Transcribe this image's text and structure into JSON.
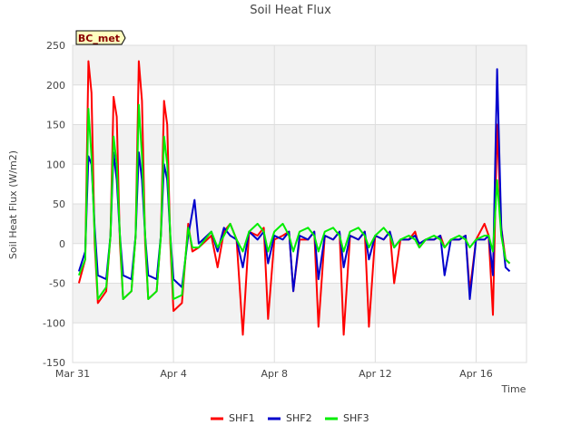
{
  "chart_data": {
    "type": "line",
    "title": "Soil Heat Flux",
    "xlabel": "Time",
    "ylabel": "Soil Heat Flux (W/m2)",
    "badge": "BC_met",
    "ylim": [
      -150,
      250
    ],
    "yticks": [
      -150,
      -100,
      -50,
      0,
      50,
      100,
      150,
      200,
      250
    ],
    "xlim": [
      "2024-03-31",
      "2024-04-18"
    ],
    "xticks": [
      {
        "x": "2024-03-31",
        "label": "Mar 31"
      },
      {
        "x": "2024-04-04",
        "label": "Apr 4"
      },
      {
        "x": "2024-04-08",
        "label": "Apr 8"
      },
      {
        "x": "2024-04-12",
        "label": "Apr 12"
      },
      {
        "x": "2024-04-16",
        "label": "Apr 16"
      }
    ],
    "legend_position": "bottom",
    "grid": true,
    "series": [
      {
        "name": "SHF1",
        "color": "#ff0000",
        "points": [
          [
            "2024-03-31 06:00",
            -50
          ],
          [
            "2024-03-31 12:00",
            -20
          ],
          [
            "2024-03-31 15:00",
            230
          ],
          [
            "2024-03-31 18:00",
            190
          ],
          [
            "2024-03-31 21:00",
            0
          ],
          [
            "2024-04-01 00:00",
            -75
          ],
          [
            "2024-04-01 08:00",
            -60
          ],
          [
            "2024-04-01 12:00",
            10
          ],
          [
            "2024-04-01 15:00",
            185
          ],
          [
            "2024-04-01 18:00",
            160
          ],
          [
            "2024-04-01 21:00",
            0
          ],
          [
            "2024-04-02 00:00",
            -70
          ],
          [
            "2024-04-02 08:00",
            -60
          ],
          [
            "2024-04-02 12:00",
            10
          ],
          [
            "2024-04-02 15:00",
            230
          ],
          [
            "2024-04-02 18:00",
            180
          ],
          [
            "2024-04-02 21:00",
            0
          ],
          [
            "2024-04-03 00:00",
            -70
          ],
          [
            "2024-04-03 08:00",
            -60
          ],
          [
            "2024-04-03 12:00",
            10
          ],
          [
            "2024-04-03 15:00",
            180
          ],
          [
            "2024-04-03 18:00",
            150
          ],
          [
            "2024-04-03 21:00",
            0
          ],
          [
            "2024-04-04 00:00",
            -85
          ],
          [
            "2024-04-04 08:00",
            -75
          ],
          [
            "2024-04-04 14:00",
            25
          ],
          [
            "2024-04-04 18:00",
            -10
          ],
          [
            "2024-04-05 00:00",
            -5
          ],
          [
            "2024-04-05 12:00",
            10
          ],
          [
            "2024-04-05 18:00",
            -30
          ],
          [
            "2024-04-06 00:00",
            15
          ],
          [
            "2024-04-06 06:00",
            25
          ],
          [
            "2024-04-06 12:00",
            5
          ],
          [
            "2024-04-06 18:00",
            -115
          ],
          [
            "2024-04-07 00:00",
            15
          ],
          [
            "2024-04-07 08:00",
            10
          ],
          [
            "2024-04-07 14:00",
            20
          ],
          [
            "2024-04-07 18:00",
            -95
          ],
          [
            "2024-04-08 00:00",
            5
          ],
          [
            "2024-04-08 08:00",
            10
          ],
          [
            "2024-04-08 14:00",
            15
          ],
          [
            "2024-04-08 18:00",
            -60
          ],
          [
            "2024-04-09 00:00",
            5
          ],
          [
            "2024-04-09 08:00",
            5
          ],
          [
            "2024-04-09 14:00",
            15
          ],
          [
            "2024-04-09 18:00",
            -105
          ],
          [
            "2024-04-10 00:00",
            10
          ],
          [
            "2024-04-10 08:00",
            5
          ],
          [
            "2024-04-10 14:00",
            15
          ],
          [
            "2024-04-10 18:00",
            -115
          ],
          [
            "2024-04-11 00:00",
            10
          ],
          [
            "2024-04-11 08:00",
            5
          ],
          [
            "2024-04-11 14:00",
            15
          ],
          [
            "2024-04-11 18:00",
            -105
          ],
          [
            "2024-04-12 00:00",
            10
          ],
          [
            "2024-04-12 08:00",
            5
          ],
          [
            "2024-04-12 14:00",
            15
          ],
          [
            "2024-04-12 18:00",
            -50
          ],
          [
            "2024-04-13 00:00",
            5
          ],
          [
            "2024-04-13 08:00",
            5
          ],
          [
            "2024-04-13 14:00",
            15
          ],
          [
            "2024-04-13 18:00",
            -5
          ],
          [
            "2024-04-14 00:00",
            5
          ],
          [
            "2024-04-14 08:00",
            5
          ],
          [
            "2024-04-14 14:00",
            10
          ],
          [
            "2024-04-14 18:00",
            -5
          ],
          [
            "2024-04-15 00:00",
            5
          ],
          [
            "2024-04-15 08:00",
            5
          ],
          [
            "2024-04-15 14:00",
            10
          ],
          [
            "2024-04-15 18:00",
            -60
          ],
          [
            "2024-04-16 00:00",
            5
          ],
          [
            "2024-04-16 08:00",
            25
          ],
          [
            "2024-04-16 12:00",
            10
          ],
          [
            "2024-04-16 16:00",
            -90
          ],
          [
            "2024-04-16 20:00",
            150
          ],
          [
            "2024-04-17 00:00",
            20
          ],
          [
            "2024-04-17 04:00",
            -20
          ],
          [
            "2024-04-17 08:00",
            -25
          ]
        ]
      },
      {
        "name": "SHF2",
        "color": "#0000cc",
        "points": [
          [
            "2024-03-31 06:00",
            -35
          ],
          [
            "2024-03-31 12:00",
            -10
          ],
          [
            "2024-03-31 15:00",
            110
          ],
          [
            "2024-03-31 18:00",
            100
          ],
          [
            "2024-03-31 21:00",
            20
          ],
          [
            "2024-04-01 00:00",
            -40
          ],
          [
            "2024-04-01 08:00",
            -45
          ],
          [
            "2024-04-01 12:00",
            10
          ],
          [
            "2024-04-01 15:00",
            115
          ],
          [
            "2024-04-01 18:00",
            80
          ],
          [
            "2024-04-01 21:00",
            10
          ],
          [
            "2024-04-02 00:00",
            -40
          ],
          [
            "2024-04-02 08:00",
            -45
          ],
          [
            "2024-04-02 12:00",
            10
          ],
          [
            "2024-04-02 15:00",
            115
          ],
          [
            "2024-04-02 18:00",
            80
          ],
          [
            "2024-04-02 21:00",
            10
          ],
          [
            "2024-04-03 00:00",
            -40
          ],
          [
            "2024-04-03 08:00",
            -45
          ],
          [
            "2024-04-03 12:00",
            10
          ],
          [
            "2024-04-03 15:00",
            100
          ],
          [
            "2024-04-03 18:00",
            80
          ],
          [
            "2024-04-03 21:00",
            10
          ],
          [
            "2024-04-04 00:00",
            -45
          ],
          [
            "2024-04-04 08:00",
            -55
          ],
          [
            "2024-04-04 14:00",
            10
          ],
          [
            "2024-04-04 20:00",
            55
          ],
          [
            "2024-04-05 00:00",
            0
          ],
          [
            "2024-04-05 12:00",
            15
          ],
          [
            "2024-04-05 18:00",
            -10
          ],
          [
            "2024-04-06 00:00",
            20
          ],
          [
            "2024-04-06 06:00",
            10
          ],
          [
            "2024-04-06 12:00",
            5
          ],
          [
            "2024-04-06 18:00",
            -30
          ],
          [
            "2024-04-07 00:00",
            15
          ],
          [
            "2024-04-07 08:00",
            5
          ],
          [
            "2024-04-07 14:00",
            15
          ],
          [
            "2024-04-07 18:00",
            -25
          ],
          [
            "2024-04-08 00:00",
            10
          ],
          [
            "2024-04-08 08:00",
            5
          ],
          [
            "2024-04-08 14:00",
            15
          ],
          [
            "2024-04-08 18:00",
            -60
          ],
          [
            "2024-04-09 00:00",
            10
          ],
          [
            "2024-04-09 08:00",
            5
          ],
          [
            "2024-04-09 14:00",
            15
          ],
          [
            "2024-04-09 18:00",
            -45
          ],
          [
            "2024-04-10 00:00",
            10
          ],
          [
            "2024-04-10 08:00",
            5
          ],
          [
            "2024-04-10 14:00",
            15
          ],
          [
            "2024-04-10 18:00",
            -30
          ],
          [
            "2024-04-11 00:00",
            10
          ],
          [
            "2024-04-11 08:00",
            5
          ],
          [
            "2024-04-11 14:00",
            15
          ],
          [
            "2024-04-11 18:00",
            -20
          ],
          [
            "2024-04-12 00:00",
            10
          ],
          [
            "2024-04-12 08:00",
            5
          ],
          [
            "2024-04-12 14:00",
            15
          ],
          [
            "2024-04-12 18:00",
            -5
          ],
          [
            "2024-04-13 00:00",
            5
          ],
          [
            "2024-04-13 08:00",
            5
          ],
          [
            "2024-04-13 14:00",
            10
          ],
          [
            "2024-04-13 18:00",
            0
          ],
          [
            "2024-04-14 00:00",
            5
          ],
          [
            "2024-04-14 08:00",
            5
          ],
          [
            "2024-04-14 14:00",
            10
          ],
          [
            "2024-04-14 18:00",
            -40
          ],
          [
            "2024-04-15 00:00",
            5
          ],
          [
            "2024-04-15 08:00",
            5
          ],
          [
            "2024-04-15 14:00",
            10
          ],
          [
            "2024-04-15 18:00",
            -70
          ],
          [
            "2024-04-16 00:00",
            5
          ],
          [
            "2024-04-16 08:00",
            5
          ],
          [
            "2024-04-16 12:00",
            10
          ],
          [
            "2024-04-16 16:00",
            -40
          ],
          [
            "2024-04-16 20:00",
            220
          ],
          [
            "2024-04-17 00:00",
            20
          ],
          [
            "2024-04-17 04:00",
            -30
          ],
          [
            "2024-04-17 08:00",
            -35
          ]
        ]
      },
      {
        "name": "SHF3",
        "color": "#00ee00",
        "points": [
          [
            "2024-03-31 06:00",
            -40
          ],
          [
            "2024-03-31 12:00",
            -20
          ],
          [
            "2024-03-31 15:00",
            170
          ],
          [
            "2024-03-31 18:00",
            110
          ],
          [
            "2024-03-31 21:00",
            10
          ],
          [
            "2024-04-01 00:00",
            -70
          ],
          [
            "2024-04-01 08:00",
            -55
          ],
          [
            "2024-04-01 12:00",
            10
          ],
          [
            "2024-04-01 15:00",
            135
          ],
          [
            "2024-04-01 18:00",
            100
          ],
          [
            "2024-04-01 21:00",
            10
          ],
          [
            "2024-04-02 00:00",
            -70
          ],
          [
            "2024-04-02 08:00",
            -60
          ],
          [
            "2024-04-02 12:00",
            10
          ],
          [
            "2024-04-02 15:00",
            175
          ],
          [
            "2024-04-02 18:00",
            110
          ],
          [
            "2024-04-02 21:00",
            10
          ],
          [
            "2024-04-03 00:00",
            -70
          ],
          [
            "2024-04-03 08:00",
            -60
          ],
          [
            "2024-04-03 12:00",
            10
          ],
          [
            "2024-04-03 15:00",
            135
          ],
          [
            "2024-04-03 18:00",
            100
          ],
          [
            "2024-04-03 21:00",
            10
          ],
          [
            "2024-04-04 00:00",
            -70
          ],
          [
            "2024-04-04 08:00",
            -65
          ],
          [
            "2024-04-04 14:00",
            20
          ],
          [
            "2024-04-04 18:00",
            -5
          ],
          [
            "2024-04-05 00:00",
            -5
          ],
          [
            "2024-04-05 12:00",
            15
          ],
          [
            "2024-04-05 18:00",
            -5
          ],
          [
            "2024-04-06 00:00",
            10
          ],
          [
            "2024-04-06 06:00",
            25
          ],
          [
            "2024-04-06 12:00",
            5
          ],
          [
            "2024-04-06 18:00",
            -10
          ],
          [
            "2024-04-07 00:00",
            15
          ],
          [
            "2024-04-07 08:00",
            25
          ],
          [
            "2024-04-07 14:00",
            15
          ],
          [
            "2024-04-07 18:00",
            -10
          ],
          [
            "2024-04-08 00:00",
            15
          ],
          [
            "2024-04-08 08:00",
            25
          ],
          [
            "2024-04-08 14:00",
            10
          ],
          [
            "2024-04-08 18:00",
            -10
          ],
          [
            "2024-04-09 00:00",
            15
          ],
          [
            "2024-04-09 08:00",
            20
          ],
          [
            "2024-04-09 14:00",
            10
          ],
          [
            "2024-04-09 18:00",
            -10
          ],
          [
            "2024-04-10 00:00",
            15
          ],
          [
            "2024-04-10 08:00",
            20
          ],
          [
            "2024-04-10 14:00",
            10
          ],
          [
            "2024-04-10 18:00",
            -10
          ],
          [
            "2024-04-11 00:00",
            15
          ],
          [
            "2024-04-11 08:00",
            20
          ],
          [
            "2024-04-11 14:00",
            10
          ],
          [
            "2024-04-11 18:00",
            -5
          ],
          [
            "2024-04-12 00:00",
            10
          ],
          [
            "2024-04-12 08:00",
            20
          ],
          [
            "2024-04-12 14:00",
            10
          ],
          [
            "2024-04-12 18:00",
            -5
          ],
          [
            "2024-04-13 00:00",
            5
          ],
          [
            "2024-04-13 08:00",
            10
          ],
          [
            "2024-04-13 14:00",
            5
          ],
          [
            "2024-04-13 18:00",
            -5
          ],
          [
            "2024-04-14 00:00",
            5
          ],
          [
            "2024-04-14 08:00",
            10
          ],
          [
            "2024-04-14 14:00",
            5
          ],
          [
            "2024-04-14 18:00",
            -5
          ],
          [
            "2024-04-15 00:00",
            5
          ],
          [
            "2024-04-15 08:00",
            10
          ],
          [
            "2024-04-15 14:00",
            5
          ],
          [
            "2024-04-15 18:00",
            -5
          ],
          [
            "2024-04-16 00:00",
            5
          ],
          [
            "2024-04-16 08:00",
            10
          ],
          [
            "2024-04-16 12:00",
            10
          ],
          [
            "2024-04-16 16:00",
            -10
          ],
          [
            "2024-04-16 20:00",
            80
          ],
          [
            "2024-04-17 00:00",
            10
          ],
          [
            "2024-04-17 04:00",
            -20
          ],
          [
            "2024-04-17 08:00",
            -25
          ]
        ]
      }
    ]
  }
}
